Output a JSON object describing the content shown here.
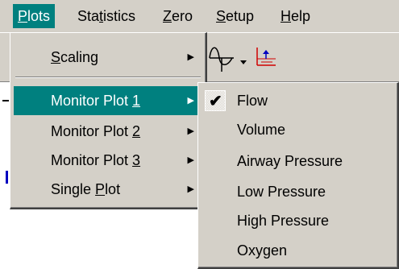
{
  "menubar": {
    "items": [
      {
        "label_pre": "",
        "label_ul": "P",
        "label_post": "lots"
      },
      {
        "label_pre": "Sta",
        "label_ul": "t",
        "label_post": "istics"
      },
      {
        "label_pre": "",
        "label_ul": "Z",
        "label_post": "ero"
      },
      {
        "label_pre": "",
        "label_ul": "S",
        "label_post": "etup"
      },
      {
        "label_pre": "",
        "label_ul": "H",
        "label_post": "elp"
      }
    ]
  },
  "toolbar": {
    "wave_icon": "waveform-icon",
    "dropdown_icon": "dropdown-arrow-icon",
    "chart_icon": "chart-icon",
    "chart_color": "#d00000"
  },
  "plots_menu": {
    "items": [
      {
        "label_pre": "",
        "label_ul": "S",
        "label_post": "caling",
        "has_submenu": true
      },
      {
        "label_pre": "Monitor Plot ",
        "label_ul": "1",
        "label_post": "",
        "has_submenu": true,
        "selected": true
      },
      {
        "label_pre": "Monitor Plot ",
        "label_ul": "2",
        "label_post": "",
        "has_submenu": true
      },
      {
        "label_pre": "Monitor Plot ",
        "label_ul": "3",
        "label_post": "",
        "has_submenu": true
      },
      {
        "label_pre": "Single ",
        "label_ul": "P",
        "label_post": "lot",
        "has_submenu": true
      }
    ]
  },
  "submenu": {
    "items": [
      {
        "label": "Flow",
        "checked": true
      },
      {
        "label": "Volume",
        "checked": false
      },
      {
        "label": "Airway Pressure",
        "checked": false
      },
      {
        "label": "Low Pressure",
        "checked": false
      },
      {
        "label": "High Pressure",
        "checked": false
      },
      {
        "label": "Oxygen",
        "checked": false
      }
    ]
  },
  "colors": {
    "highlight": "#00807f",
    "menu_bg": "#d4d0c8"
  }
}
